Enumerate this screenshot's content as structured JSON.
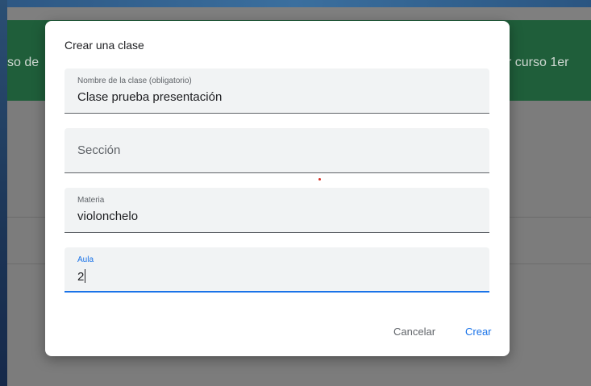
{
  "background": {
    "banner_left_text": "so de",
    "banner_right_text": "r curso 1er"
  },
  "dialog": {
    "title": "Crear una clase",
    "fields": {
      "class_name": {
        "label": "Nombre de la clase (obligatorio)",
        "value": "Clase prueba presentación"
      },
      "section": {
        "placeholder": "Sección"
      },
      "subject": {
        "label": "Materia",
        "value": "violonchelo"
      },
      "room": {
        "label": "Aula",
        "value": "2"
      }
    },
    "buttons": {
      "cancel": "Cancelar",
      "create": "Crear"
    }
  },
  "colors": {
    "accent": "#1a73e8",
    "banner": "#1f5e3a",
    "field_background": "#f1f3f4"
  }
}
